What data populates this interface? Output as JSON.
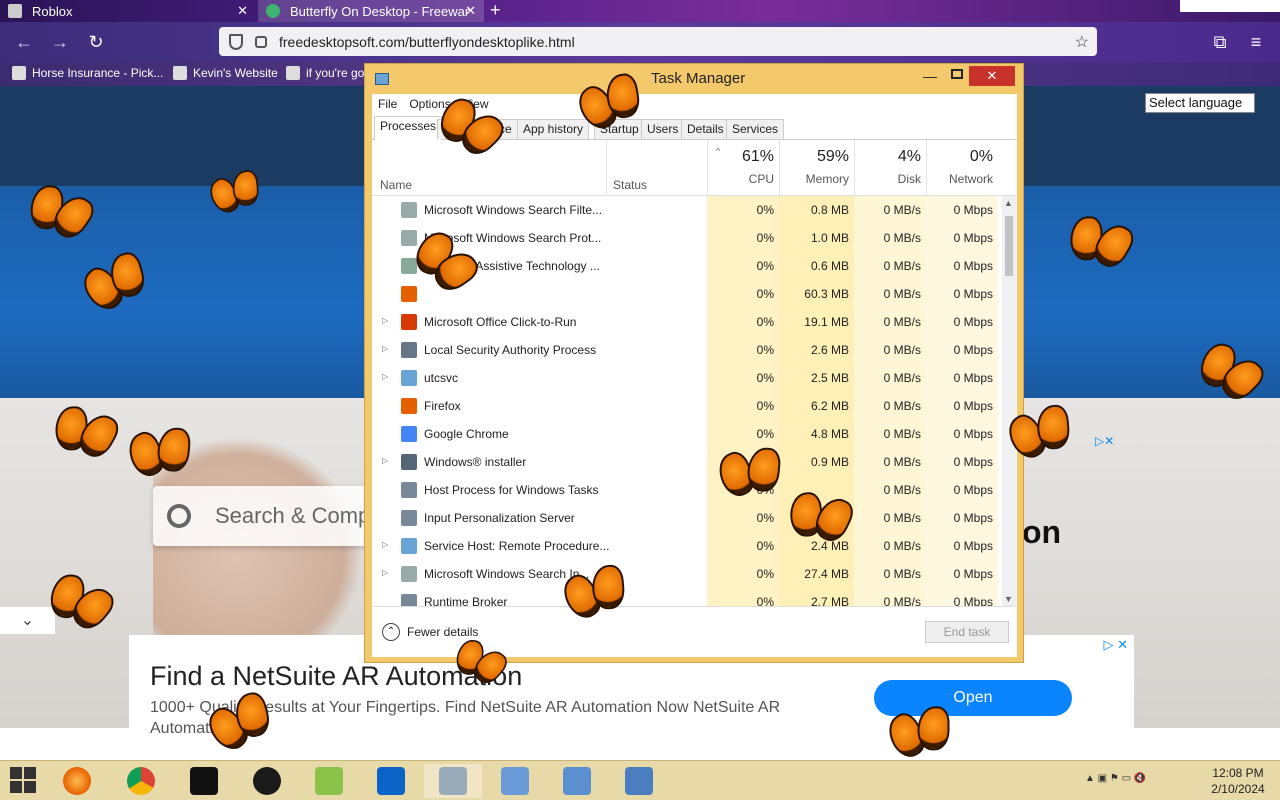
{
  "browser": {
    "tabs": [
      {
        "label": "Roblox"
      },
      {
        "label": "Butterfly On Desktop - Freewar"
      }
    ],
    "url": "freedesktopsoft.com/butterflyondesktoplike.html",
    "bookmarks": [
      {
        "label": "Horse Insurance - Pick..."
      },
      {
        "label": "Kevin's Website"
      },
      {
        "label": "if you're go"
      }
    ]
  },
  "page": {
    "language_select": "Select language",
    "search_placeholder": "Search & Comp",
    "side_text": "on",
    "ad": {
      "title": "Find a NetSuite AR Automation",
      "description": "1000+ Quality Results at Your Fingertips. Find NetSuite AR Automation Now NetSuite AR Automation",
      "open_button": "Open"
    }
  },
  "task_manager": {
    "title": "Task Manager",
    "menu": [
      "File",
      "Options",
      "View"
    ],
    "tabs": [
      "Processes",
      "Performance",
      "App history",
      "Startup",
      "Users",
      "Details",
      "Services"
    ],
    "columns": {
      "name": "Name",
      "status": "Status",
      "cpu": {
        "pct": "61%",
        "label": "CPU"
      },
      "memory": {
        "pct": "59%",
        "label": "Memory"
      },
      "disk": {
        "pct": "4%",
        "label": "Disk"
      },
      "network": {
        "pct": "0%",
        "label": "Network"
      }
    },
    "processes": [
      {
        "name": "Microsoft Windows Search Filte...",
        "cpu": "0%",
        "memory": "0.8 MB",
        "disk": "0 MB/s",
        "network": "0 Mbps",
        "expandable": false
      },
      {
        "name": "Microsoft Windows Search Prot...",
        "cpu": "0%",
        "memory": "1.0 MB",
        "disk": "0 MB/s",
        "network": "0 Mbps",
        "expandable": false
      },
      {
        "name": "Windows Assistive Technology ...",
        "cpu": "0%",
        "memory": "0.6 MB",
        "disk": "0 MB/s",
        "network": "0 Mbps",
        "expandable": false
      },
      {
        "name": "",
        "cpu": "0%",
        "memory": "60.3 MB",
        "disk": "0 MB/s",
        "network": "0 Mbps",
        "expandable": false
      },
      {
        "name": "Microsoft Office Click-to-Run",
        "cpu": "0%",
        "memory": "19.1 MB",
        "disk": "0 MB/s",
        "network": "0 Mbps",
        "expandable": true
      },
      {
        "name": "Local Security Authority Process",
        "cpu": "0%",
        "memory": "2.6 MB",
        "disk": "0 MB/s",
        "network": "0 Mbps",
        "expandable": true
      },
      {
        "name": "utcsvc",
        "cpu": "0%",
        "memory": "2.5 MB",
        "disk": "0 MB/s",
        "network": "0 Mbps",
        "expandable": true
      },
      {
        "name": "Firefox",
        "cpu": "0%",
        "memory": "6.2 MB",
        "disk": "0 MB/s",
        "network": "0 Mbps",
        "expandable": false
      },
      {
        "name": "Google Chrome",
        "cpu": "0%",
        "memory": "4.8 MB",
        "disk": "0 MB/s",
        "network": "0 Mbps",
        "expandable": false
      },
      {
        "name": "Windows® installer",
        "cpu": "0%",
        "memory": "0.9 MB",
        "disk": "0 MB/s",
        "network": "0 Mbps",
        "expandable": true
      },
      {
        "name": "Host Process for Windows Tasks",
        "cpu": "0%",
        "memory": "",
        "disk": "0 MB/s",
        "network": "0 Mbps",
        "expandable": false
      },
      {
        "name": "Input Personalization Server",
        "cpu": "0%",
        "memory": "",
        "disk": "0 MB/s",
        "network": "0 Mbps",
        "expandable": false
      },
      {
        "name": "Service Host: Remote Procedure...",
        "cpu": "0%",
        "memory": "2.4 MB",
        "disk": "0 MB/s",
        "network": "0 Mbps",
        "expandable": true
      },
      {
        "name": "Microsoft Windows Search In...",
        "cpu": "0%",
        "memory": "27.4 MB",
        "disk": "0 MB/s",
        "network": "0 Mbps",
        "expandable": true
      },
      {
        "name": "Runtime Broker",
        "cpu": "0%",
        "memory": "2.7 MB",
        "disk": "0 MB/s",
        "network": "0 Mbps",
        "expandable": false
      }
    ],
    "fewer_details": "Fewer details",
    "end_task": "End task"
  },
  "taskbar": {
    "time": "12:08 PM",
    "date": "2/10/2024"
  }
}
